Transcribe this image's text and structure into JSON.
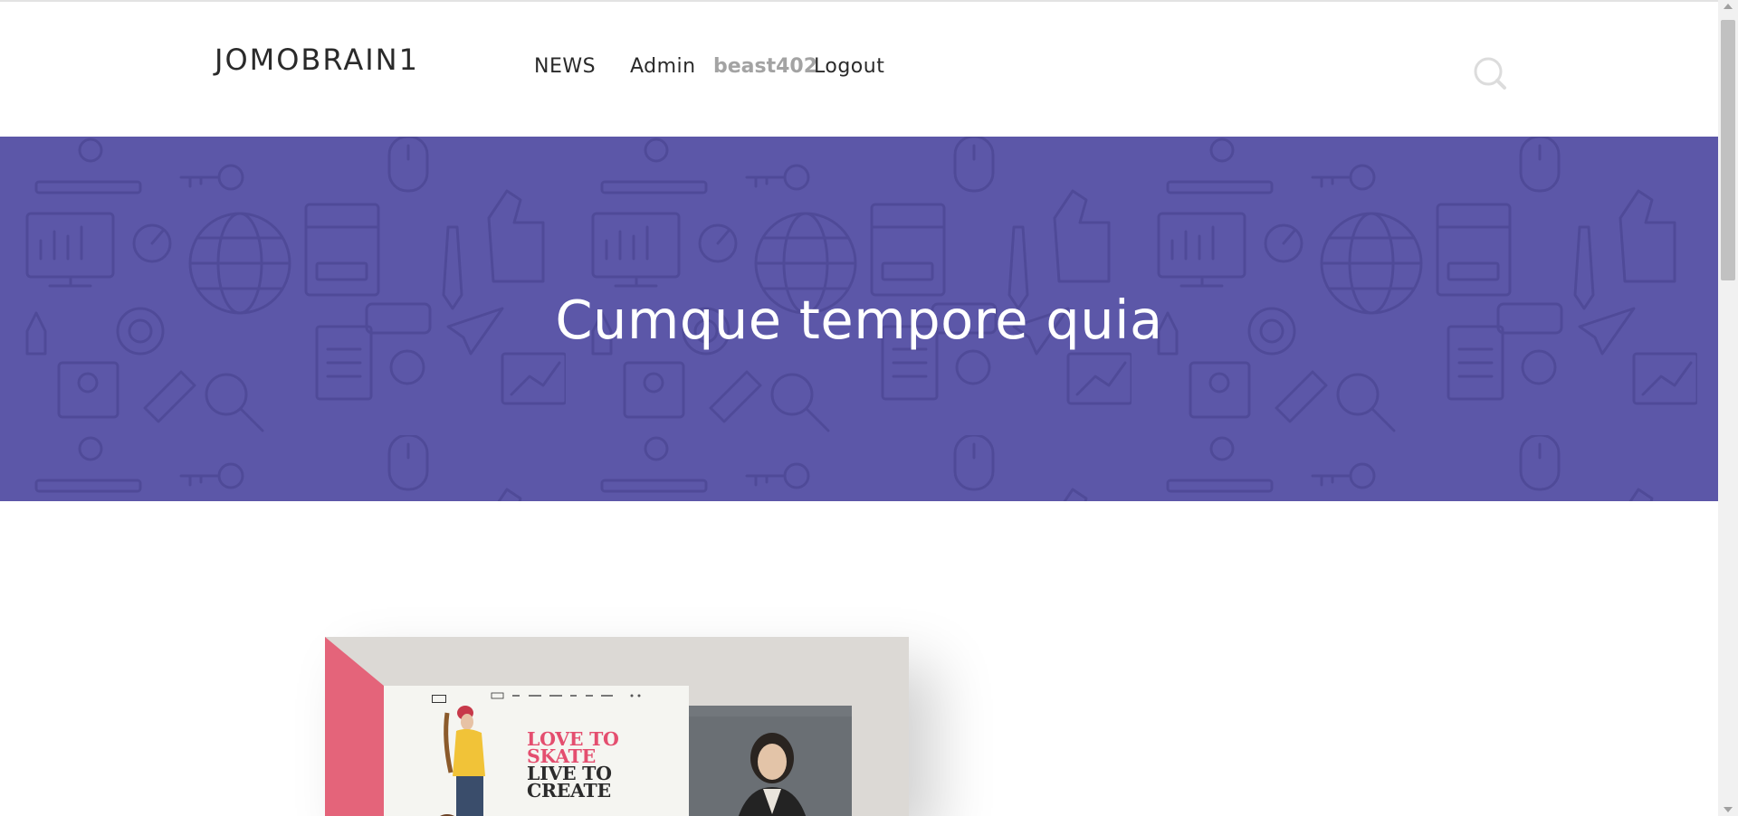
{
  "brand": "JOMOBRAIN1",
  "nav": {
    "news": "NEWS",
    "admin": "Admin",
    "user": "beast402",
    "logout": "Logout"
  },
  "hero": {
    "title": "Cumque tempore quia",
    "background_color": "#5c57a8"
  },
  "icons": {
    "search": "search-icon"
  },
  "showcase": {
    "headline_line1": "LOVE TO",
    "headline_line2": "SKATE",
    "headline_line3": "LIVE TO",
    "headline_line4": "CREATE",
    "accent_color": "#e44e6f"
  }
}
